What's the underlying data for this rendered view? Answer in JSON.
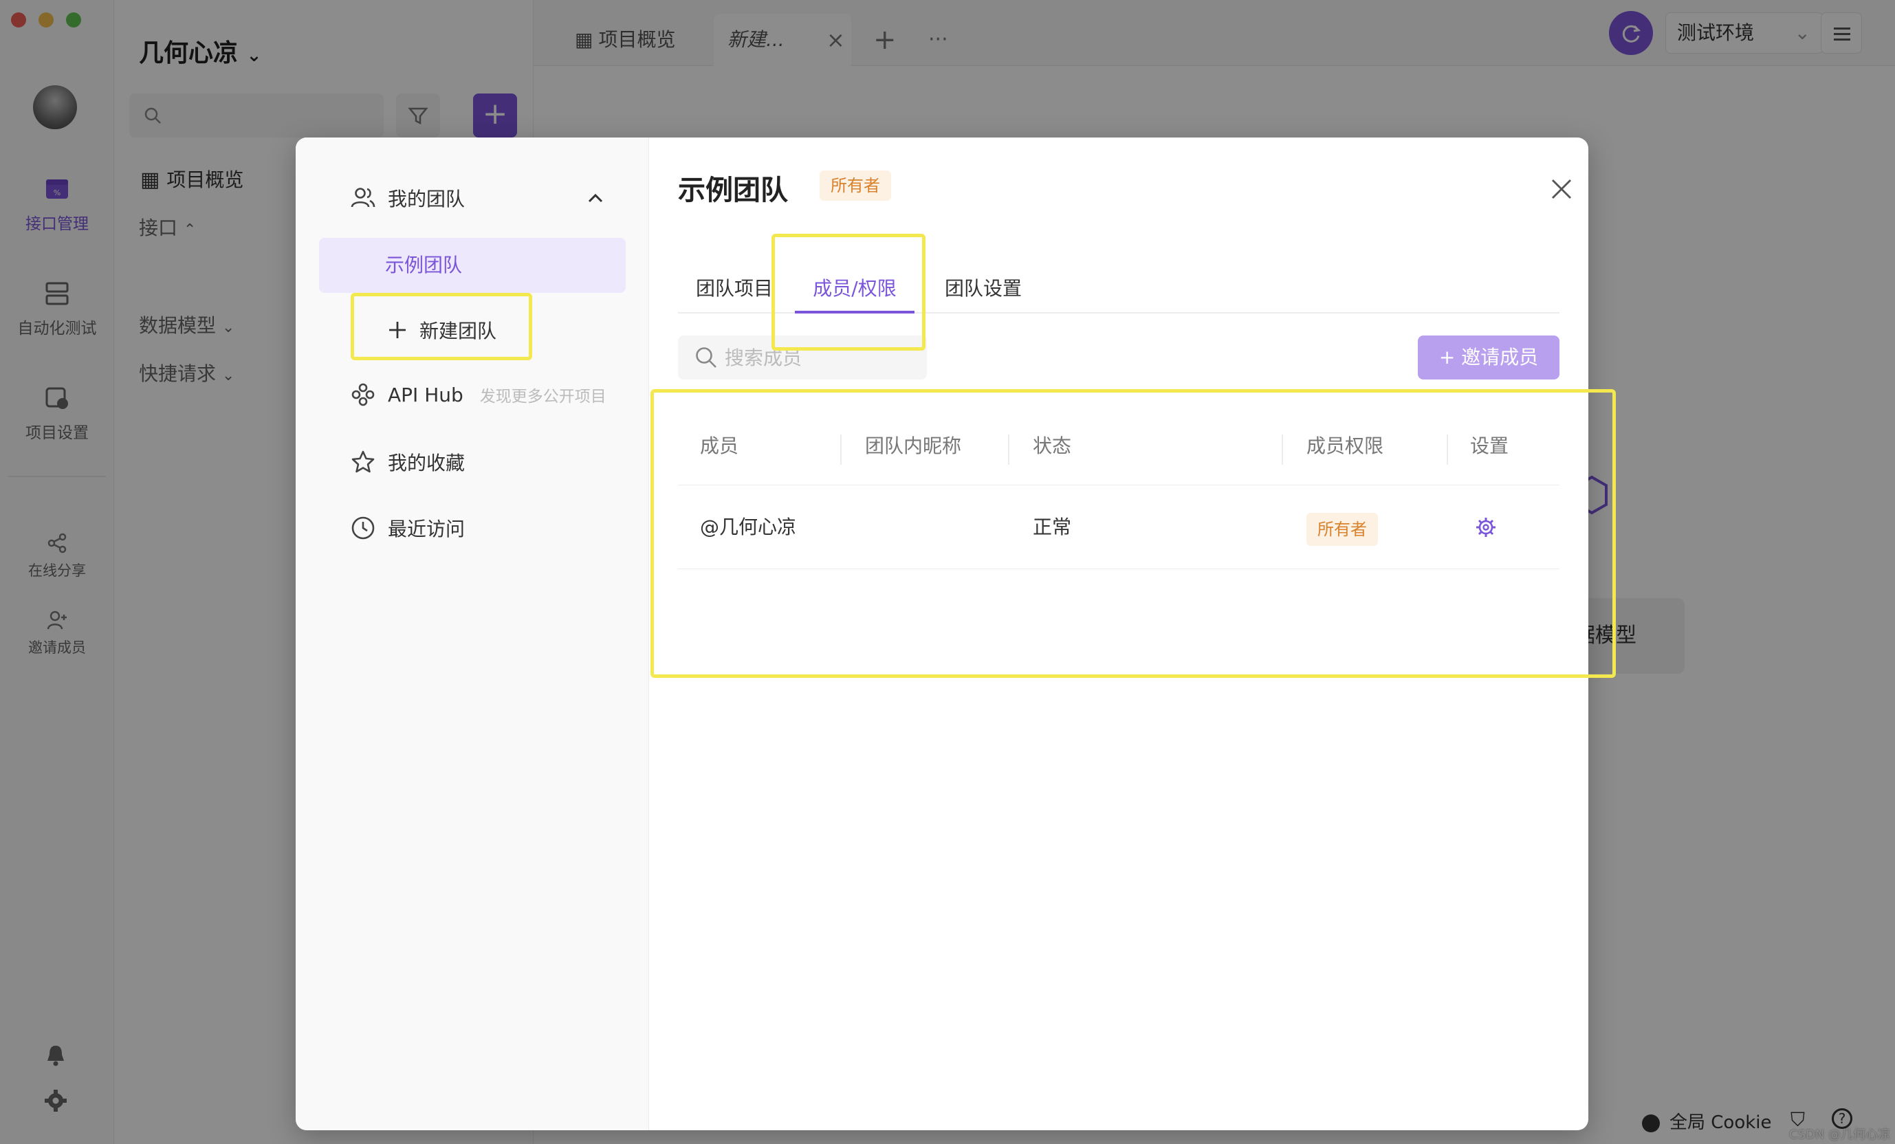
{
  "window": {
    "traffic_colors": [
      "#ee5f57",
      "#f4bd4f",
      "#61c554"
    ]
  },
  "rail": {
    "items": [
      {
        "label": "接口管理",
        "icon": "api-management-icon",
        "active": true
      },
      {
        "label": "自动化测试",
        "icon": "automation-test-icon",
        "active": false
      },
      {
        "label": "项目设置",
        "icon": "project-settings-icon",
        "active": false
      },
      {
        "label": "在线分享",
        "icon": "share-icon",
        "active": false
      },
      {
        "label": "邀请成员",
        "icon": "invite-member-icon",
        "active": false
      }
    ],
    "bottom_icons": [
      "bell-icon",
      "gear-icon"
    ]
  },
  "tree": {
    "project_title": "几何心凉",
    "overview": "项目概览",
    "api": "接口",
    "data_model": "数据模型",
    "quick_request": "快捷请求"
  },
  "tabbar": {
    "tabs": [
      {
        "label": "项目概览",
        "active": false
      },
      {
        "label": "新建...",
        "active": true
      }
    ],
    "add_label": "+",
    "more_label": "···",
    "environment": "测试环境"
  },
  "background": {
    "card_label": "据模型"
  },
  "statusbar": {
    "cookie_label": "全局 Cookie"
  },
  "watermark": "CSDN @几何心凉",
  "modal": {
    "sidebar": {
      "my_team": "我的团队",
      "selected_team": "示例团队",
      "new_team": "新建团队",
      "api_hub": "API Hub",
      "api_hub_hint": "发现更多公开项目",
      "favorites": "我的收藏",
      "recent": "最近访问"
    },
    "title": "示例团队",
    "owner_badge": "所有者",
    "tabs": [
      {
        "label": "团队项目",
        "active": false
      },
      {
        "label": "成员/权限",
        "active": true
      },
      {
        "label": "团队设置",
        "active": false
      }
    ],
    "search_placeholder": "搜索成员",
    "invite_button": "+ 邀请成员",
    "table": {
      "columns": [
        "成员",
        "团队内昵称",
        "状态",
        "成员权限",
        "设置"
      ],
      "rows": [
        {
          "member": "@几何心凉",
          "nickname": "",
          "status": "正常",
          "role": "所有者",
          "setting_icon": "gear-icon"
        }
      ]
    }
  },
  "colors": {
    "accent": "#7b55d9",
    "accent_light": "#b9a0ee",
    "owner_badge_bg": "#fdf1e4",
    "owner_badge_text": "#d9822b",
    "highlight": "#f3e84e"
  }
}
